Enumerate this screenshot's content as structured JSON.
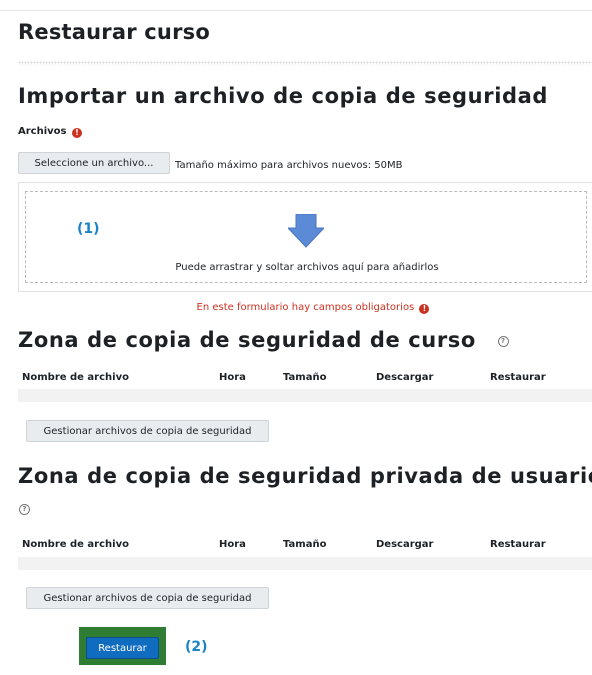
{
  "page_title": "Restaurar curso",
  "import": {
    "heading": "Importar un archivo de copia de seguridad",
    "files_label": "Archivos",
    "required_icon": "!",
    "select_button": "Seleccione un archivo...",
    "max_size": "Tamaño máximo para archivos nuevos: 50MB",
    "drop_hint": "Puede arrastrar y soltar archivos aquí para añadirlos",
    "annotation": "(1)",
    "form_required": "En este formulario hay campos obligatorios"
  },
  "course_zone": {
    "heading": "Zona de copia de seguridad de curso",
    "columns": [
      "Nombre de archivo",
      "Hora",
      "Tamaño",
      "Descargar",
      "Restaurar"
    ],
    "manage_button": "Gestionar archivos de copia de seguridad"
  },
  "user_zone": {
    "heading": "Zona de copia de seguridad privada de usuario",
    "columns": [
      "Nombre de archivo",
      "Hora",
      "Tamaño",
      "Descargar",
      "Restaurar"
    ],
    "manage_button": "Gestionar archivos de copia de seguridad"
  },
  "restore": {
    "button": "Restaurar",
    "annotation": "(2)"
  },
  "icons": {
    "help": "question-circle-icon",
    "required": "exclamation-circle-icon",
    "upload": "arrow-down-icon"
  },
  "colors": {
    "accent": "#0f6cbf",
    "required": "#ca3120",
    "annotation": "#1b84c9",
    "highlight_frame": "#2e7d32"
  }
}
